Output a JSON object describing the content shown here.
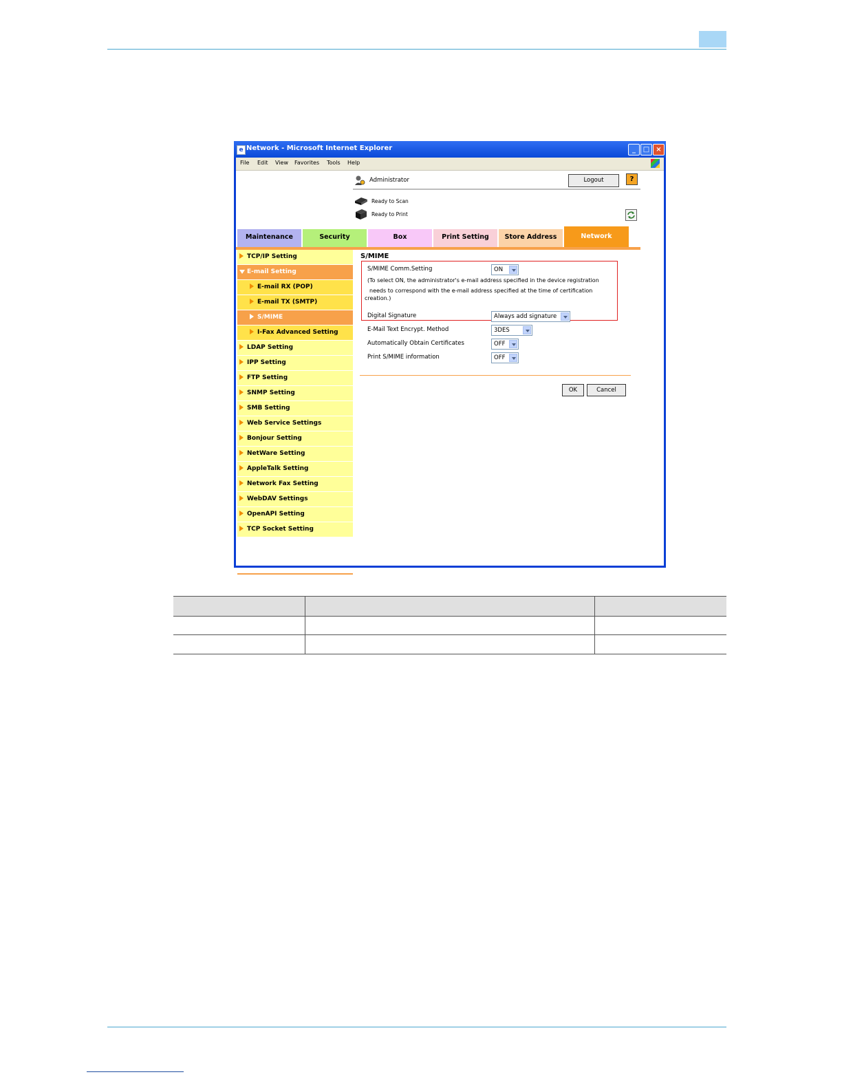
{
  "window": {
    "title": "Network - Microsoft Internet Explorer",
    "menu": [
      "File",
      "Edit",
      "View",
      "Favorites",
      "Tools",
      "Help"
    ]
  },
  "header": {
    "user_label": "Administrator",
    "logout_label": "Logout",
    "help_label": "?",
    "scan_status": "Ready to Scan",
    "print_status": "Ready to Print"
  },
  "tabs": [
    {
      "label": "Maintenance",
      "color": "#b3b3f0"
    },
    {
      "label": "Security",
      "color": "#b5f07a"
    },
    {
      "label": "Box",
      "color": "#f8c8f8"
    },
    {
      "label": "Print Setting",
      "color": "#f9d0d8"
    },
    {
      "label": "Store Address",
      "color": "#fbd3a8"
    },
    {
      "label": "Network",
      "color": "#f79a1a",
      "active": true
    }
  ],
  "nav": [
    {
      "label": "TCP/IP Setting"
    },
    {
      "label": "E-mail Setting",
      "state": "open"
    },
    {
      "label": "E-mail RX (POP)",
      "level": 2
    },
    {
      "label": "E-mail TX (SMTP)",
      "level": 2
    },
    {
      "label": "S/MIME",
      "level": 2,
      "state": "current"
    },
    {
      "label": "I-Fax Advanced Setting",
      "level": 2
    },
    {
      "label": "LDAP Setting"
    },
    {
      "label": "IPP Setting"
    },
    {
      "label": "FTP Setting"
    },
    {
      "label": "SNMP Setting"
    },
    {
      "label": "SMB Setting"
    },
    {
      "label": "Web Service Settings"
    },
    {
      "label": "Bonjour Setting"
    },
    {
      "label": "NetWare Setting"
    },
    {
      "label": "AppleTalk Setting"
    },
    {
      "label": "Network Fax Setting"
    },
    {
      "label": "WebDAV Settings"
    },
    {
      "label": "OpenAPI Setting"
    },
    {
      "label": "TCP Socket Setting"
    }
  ],
  "form": {
    "title": "S/MIME",
    "smime_comm_label": "S/MIME Comm.Setting",
    "smime_comm_value": "ON",
    "note_line1": "(To select ON, the administrator's e-mail address specified in the device registration",
    "note_line2": "needs to correspond with the e-mail address specified at the time of certification",
    "note_line3": "creation.)",
    "digital_signature_label": "Digital Signature",
    "digital_signature_value": "Always add signature",
    "encrypt_label": "E-Mail Text Encrypt. Method",
    "encrypt_value": "3DES",
    "auto_cert_label": "Automatically Obtain Certificates",
    "auto_cert_value": "OFF",
    "print_info_label": "Print S/MIME information",
    "print_info_value": "OFF",
    "ok_label": "OK",
    "cancel_label": "Cancel"
  }
}
